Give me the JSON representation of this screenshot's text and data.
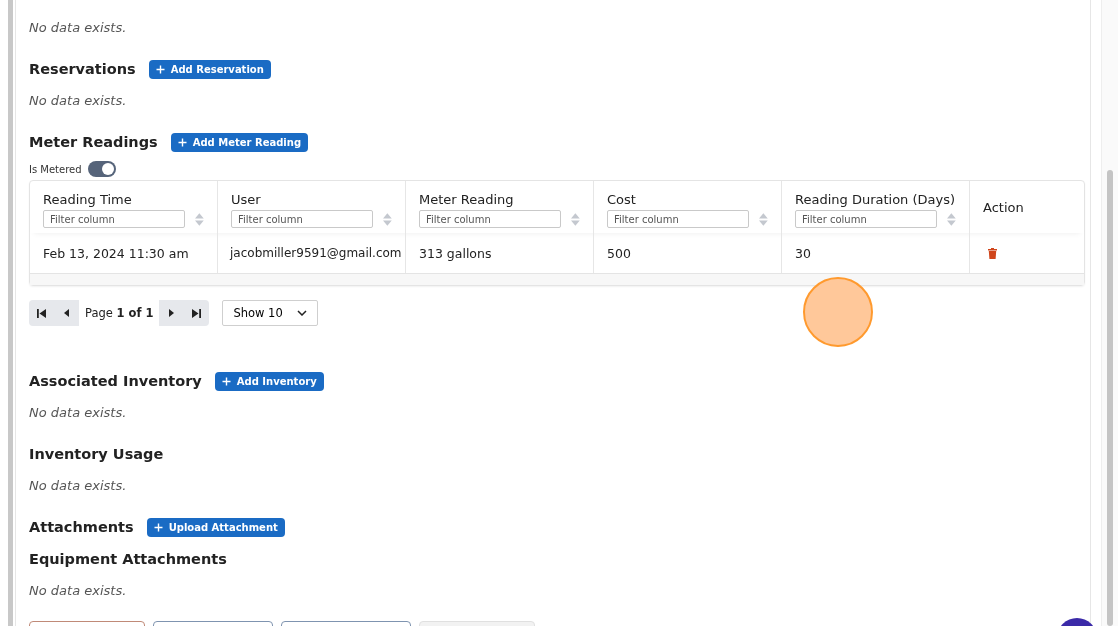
{
  "sections": [
    {
      "kind": "empty",
      "empty_text": "No data exists."
    },
    {
      "kind": "empty",
      "title": "Reservations",
      "button": "Add Reservation",
      "empty_text": "No data exists."
    },
    {
      "kind": "table",
      "title": "Meter Readings",
      "button": "Add Meter Reading"
    },
    {
      "kind": "empty",
      "title": "Associated Inventory",
      "button": "Add Inventory",
      "empty_text": "No data exists."
    },
    {
      "kind": "empty",
      "title": "Inventory Usage",
      "empty_text": "No data exists."
    },
    {
      "kind": "heading",
      "title": "Attachments",
      "button": "Upload Attachment"
    },
    {
      "kind": "empty",
      "title": "Equipment Attachments",
      "empty_text": "No data exists."
    }
  ],
  "meter_toggle": {
    "label": "Is Metered",
    "on": true
  },
  "table": {
    "columns": [
      {
        "label": "Reading Time",
        "placeholder": "Filter column"
      },
      {
        "label": "User",
        "placeholder": "Filter column"
      },
      {
        "label": "Meter Reading",
        "placeholder": "Filter column"
      },
      {
        "label": "Cost",
        "placeholder": "Filter column"
      },
      {
        "label": "Reading Duration (Days)",
        "placeholder": "Filter column"
      },
      {
        "label": "Action"
      }
    ],
    "rows": [
      [
        "Feb 13, 2024 11:30 am",
        "jacobmiller9591@gmail.com",
        "313 gallons",
        "500",
        "30"
      ]
    ]
  },
  "pager": {
    "prefix": "Page",
    "current": "1 of 1",
    "page_size": "Show 10"
  }
}
